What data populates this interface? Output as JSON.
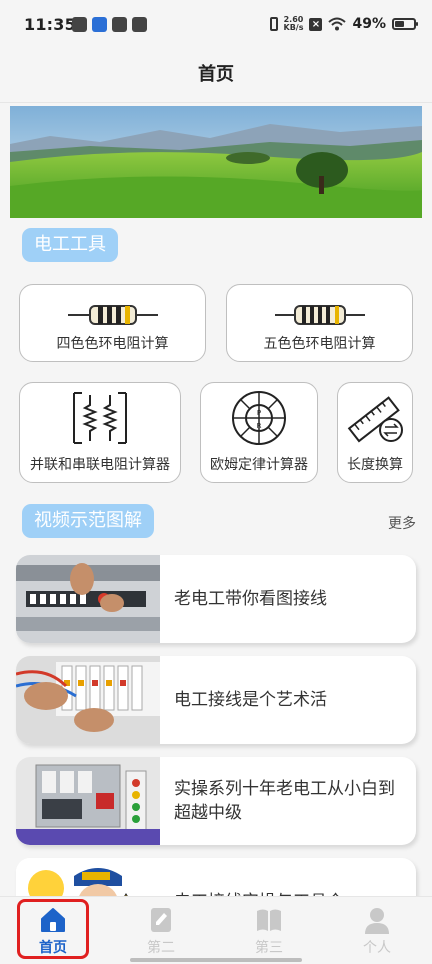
{
  "status_bar": {
    "time": "11:35",
    "network_speed_value": "2.60",
    "network_speed_unit": "KB/s",
    "battery_percent": "49%"
  },
  "header": {
    "title": "首页"
  },
  "sections": {
    "tools": {
      "title": "电工工具"
    },
    "videos": {
      "title": "视频示范图解",
      "more_label": "更多"
    }
  },
  "tools": [
    {
      "label": "四色色环电阻计算",
      "icon": "resistor-4band-icon"
    },
    {
      "label": "五色色环电阻计算",
      "icon": "resistor-5band-icon"
    },
    {
      "label": "并联和串联电阻计算器",
      "icon": "parallel-series-icon"
    },
    {
      "label": "欧姆定律计算器",
      "icon": "ohms-law-wheel-icon"
    },
    {
      "label": "长度换算",
      "icon": "ruler-convert-icon"
    }
  ],
  "videos": [
    {
      "title": "老电工带你看图接线"
    },
    {
      "title": "电工接线是个艺术活"
    },
    {
      "title": "实操系列十年老电工从小白到超越中级"
    },
    {
      "title": "电工接线实操与工具介"
    }
  ],
  "bottom_nav": [
    {
      "label": "首页",
      "icon": "home-icon",
      "active": true
    },
    {
      "label": "第二",
      "icon": "document-edit-icon",
      "active": false
    },
    {
      "label": "第三",
      "icon": "book-icon",
      "active": false
    },
    {
      "label": "个人",
      "icon": "person-icon",
      "active": false
    }
  ],
  "colors": {
    "accent": "#1d63c9",
    "pill": "#9fd0f7",
    "highlight": "#e02020",
    "inactive": "#c8c8c8"
  }
}
